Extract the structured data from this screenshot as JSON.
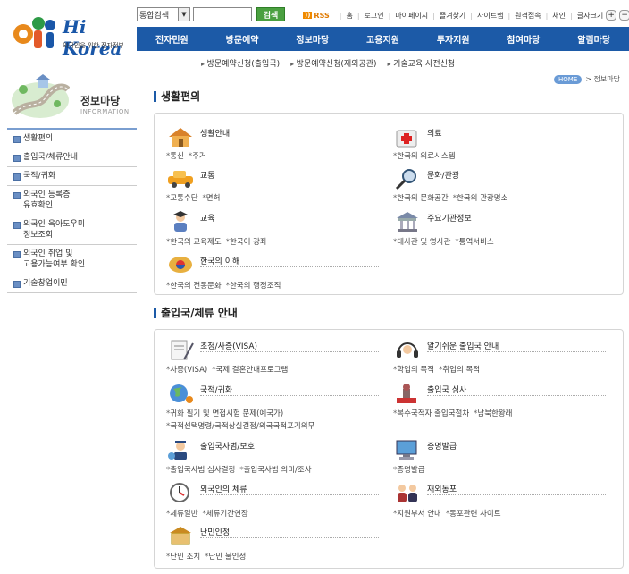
{
  "header": {
    "logo_brand": "Hi Korea",
    "logo_tagline": "외국인을 위한 전자정부",
    "search": {
      "select_value": "통합검색",
      "button_label": "검색"
    },
    "util_links": [
      "RSS",
      "홈",
      "로그인",
      "마이페이지",
      "즐겨찾기",
      "사이트맵",
      "원격접속",
      "채인",
      "글자크기"
    ],
    "font_plus": "+",
    "font_minus": "−"
  },
  "gnb": [
    "전자민원",
    "방문예약",
    "정보마당",
    "고용지원",
    "투자지원",
    "참여마당",
    "알림마당"
  ],
  "subnav": [
    "방문예약신청(출입국)",
    "방문예약신청(재외공관)",
    "기술교육 사전신청"
  ],
  "breadcrumb": {
    "home": "HOME",
    "current": "정보마당"
  },
  "sidebar": {
    "title": "정보마당",
    "subtitle": "INFORMATION",
    "items": [
      [
        "생활편의"
      ],
      [
        "출입국/체류안내"
      ],
      [
        "국적/귀화"
      ],
      [
        "외국인 등록증",
        "유효확인"
      ],
      [
        "외국인 육아도우미",
        "정보조회"
      ],
      [
        "외국인 취업 및",
        "고용가능여부 확인"
      ],
      [
        "기술창업이민"
      ]
    ]
  },
  "sections": [
    {
      "title": "생활편의",
      "entries": [
        {
          "title": "생활안내",
          "icon": "house-icon",
          "links": [
            "통신",
            "주거"
          ]
        },
        {
          "title": "의료",
          "icon": "medical-kit-icon",
          "links": [
            "한국의 의료시스템"
          ]
        },
        {
          "title": "교통",
          "icon": "car-icon",
          "links": [
            "교통수단",
            "면허"
          ]
        },
        {
          "title": "문화/관광",
          "icon": "magnifier-icon",
          "links": [
            "한국의 문화공간",
            "한국의 관광명소"
          ]
        },
        {
          "title": "교육",
          "icon": "student-icon",
          "links": [
            "한국의 교육제도",
            "한국어 강좌"
          ]
        },
        {
          "title": "주요기관정보",
          "icon": "building-icon",
          "links": [
            "대사관 및 영사관",
            "통역서비스"
          ]
        },
        {
          "title": "한국의 이해",
          "icon": "korea-icon",
          "links": [
            "한국의 전통문화",
            "한국의 행정조직"
          ]
        }
      ]
    },
    {
      "title": "출입국/체류 안내",
      "entries": [
        {
          "title": "초청/사증(VISA)",
          "icon": "visa-document-icon",
          "links": [
            "사증(VISA)",
            "국제 결혼안내프로그램"
          ]
        },
        {
          "title": "알기쉬운 출입국 안내",
          "icon": "headset-icon",
          "links": [
            "학업의 목적",
            "취업의 목적"
          ]
        },
        {
          "title": "국적/귀화",
          "icon": "globe-icon",
          "links": [
            "귀화 필기 및 면접시험 문제(예국가)",
            "국적선택명령/국적상실결정/외국국적포기의무"
          ]
        },
        {
          "title": "출입국 심사",
          "icon": "stamp-icon",
          "links": [
            "복수국적자 출입국절차",
            "남북한왕래"
          ]
        },
        {
          "title": "출입국사범/보호",
          "icon": "officer-icon",
          "links": [
            "출입국사범 심사결정",
            "출입국사범 의미/조사"
          ]
        },
        {
          "title": "증명발급",
          "icon": "computer-icon",
          "links": [
            "증명발급"
          ]
        },
        {
          "title": "외국인의 체류",
          "icon": "clock-icon",
          "links": [
            "체류일반",
            "체류기간연장"
          ]
        },
        {
          "title": "재외동포",
          "icon": "people-icon",
          "links": [
            "지원부서 안내",
            "동포관련 사이트"
          ]
        },
        {
          "title": "난민인정",
          "icon": "refugee-icon",
          "links": [
            "난민 조치",
            "난민 불인정"
          ]
        }
      ]
    }
  ]
}
